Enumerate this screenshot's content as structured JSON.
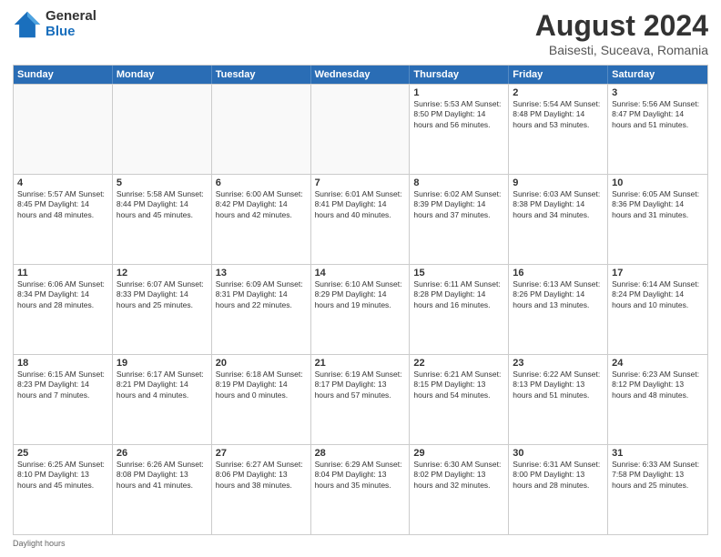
{
  "logo": {
    "general": "General",
    "blue": "Blue"
  },
  "title": {
    "month": "August 2024",
    "location": "Baisesti, Suceava, Romania"
  },
  "header_days": [
    "Sunday",
    "Monday",
    "Tuesday",
    "Wednesday",
    "Thursday",
    "Friday",
    "Saturday"
  ],
  "footer": "Daylight hours",
  "weeks": [
    [
      {
        "day": "",
        "info": "",
        "empty": true
      },
      {
        "day": "",
        "info": "",
        "empty": true
      },
      {
        "day": "",
        "info": "",
        "empty": true
      },
      {
        "day": "",
        "info": "",
        "empty": true
      },
      {
        "day": "1",
        "info": "Sunrise: 5:53 AM\nSunset: 8:50 PM\nDaylight: 14 hours\nand 56 minutes.",
        "empty": false
      },
      {
        "day": "2",
        "info": "Sunrise: 5:54 AM\nSunset: 8:48 PM\nDaylight: 14 hours\nand 53 minutes.",
        "empty": false
      },
      {
        "day": "3",
        "info": "Sunrise: 5:56 AM\nSunset: 8:47 PM\nDaylight: 14 hours\nand 51 minutes.",
        "empty": false
      }
    ],
    [
      {
        "day": "4",
        "info": "Sunrise: 5:57 AM\nSunset: 8:45 PM\nDaylight: 14 hours\nand 48 minutes.",
        "empty": false
      },
      {
        "day": "5",
        "info": "Sunrise: 5:58 AM\nSunset: 8:44 PM\nDaylight: 14 hours\nand 45 minutes.",
        "empty": false
      },
      {
        "day": "6",
        "info": "Sunrise: 6:00 AM\nSunset: 8:42 PM\nDaylight: 14 hours\nand 42 minutes.",
        "empty": false
      },
      {
        "day": "7",
        "info": "Sunrise: 6:01 AM\nSunset: 8:41 PM\nDaylight: 14 hours\nand 40 minutes.",
        "empty": false
      },
      {
        "day": "8",
        "info": "Sunrise: 6:02 AM\nSunset: 8:39 PM\nDaylight: 14 hours\nand 37 minutes.",
        "empty": false
      },
      {
        "day": "9",
        "info": "Sunrise: 6:03 AM\nSunset: 8:38 PM\nDaylight: 14 hours\nand 34 minutes.",
        "empty": false
      },
      {
        "day": "10",
        "info": "Sunrise: 6:05 AM\nSunset: 8:36 PM\nDaylight: 14 hours\nand 31 minutes.",
        "empty": false
      }
    ],
    [
      {
        "day": "11",
        "info": "Sunrise: 6:06 AM\nSunset: 8:34 PM\nDaylight: 14 hours\nand 28 minutes.",
        "empty": false
      },
      {
        "day": "12",
        "info": "Sunrise: 6:07 AM\nSunset: 8:33 PM\nDaylight: 14 hours\nand 25 minutes.",
        "empty": false
      },
      {
        "day": "13",
        "info": "Sunrise: 6:09 AM\nSunset: 8:31 PM\nDaylight: 14 hours\nand 22 minutes.",
        "empty": false
      },
      {
        "day": "14",
        "info": "Sunrise: 6:10 AM\nSunset: 8:29 PM\nDaylight: 14 hours\nand 19 minutes.",
        "empty": false
      },
      {
        "day": "15",
        "info": "Sunrise: 6:11 AM\nSunset: 8:28 PM\nDaylight: 14 hours\nand 16 minutes.",
        "empty": false
      },
      {
        "day": "16",
        "info": "Sunrise: 6:13 AM\nSunset: 8:26 PM\nDaylight: 14 hours\nand 13 minutes.",
        "empty": false
      },
      {
        "day": "17",
        "info": "Sunrise: 6:14 AM\nSunset: 8:24 PM\nDaylight: 14 hours\nand 10 minutes.",
        "empty": false
      }
    ],
    [
      {
        "day": "18",
        "info": "Sunrise: 6:15 AM\nSunset: 8:23 PM\nDaylight: 14 hours\nand 7 minutes.",
        "empty": false
      },
      {
        "day": "19",
        "info": "Sunrise: 6:17 AM\nSunset: 8:21 PM\nDaylight: 14 hours\nand 4 minutes.",
        "empty": false
      },
      {
        "day": "20",
        "info": "Sunrise: 6:18 AM\nSunset: 8:19 PM\nDaylight: 14 hours\nand 0 minutes.",
        "empty": false
      },
      {
        "day": "21",
        "info": "Sunrise: 6:19 AM\nSunset: 8:17 PM\nDaylight: 13 hours\nand 57 minutes.",
        "empty": false
      },
      {
        "day": "22",
        "info": "Sunrise: 6:21 AM\nSunset: 8:15 PM\nDaylight: 13 hours\nand 54 minutes.",
        "empty": false
      },
      {
        "day": "23",
        "info": "Sunrise: 6:22 AM\nSunset: 8:13 PM\nDaylight: 13 hours\nand 51 minutes.",
        "empty": false
      },
      {
        "day": "24",
        "info": "Sunrise: 6:23 AM\nSunset: 8:12 PM\nDaylight: 13 hours\nand 48 minutes.",
        "empty": false
      }
    ],
    [
      {
        "day": "25",
        "info": "Sunrise: 6:25 AM\nSunset: 8:10 PM\nDaylight: 13 hours\nand 45 minutes.",
        "empty": false
      },
      {
        "day": "26",
        "info": "Sunrise: 6:26 AM\nSunset: 8:08 PM\nDaylight: 13 hours\nand 41 minutes.",
        "empty": false
      },
      {
        "day": "27",
        "info": "Sunrise: 6:27 AM\nSunset: 8:06 PM\nDaylight: 13 hours\nand 38 minutes.",
        "empty": false
      },
      {
        "day": "28",
        "info": "Sunrise: 6:29 AM\nSunset: 8:04 PM\nDaylight: 13 hours\nand 35 minutes.",
        "empty": false
      },
      {
        "day": "29",
        "info": "Sunrise: 6:30 AM\nSunset: 8:02 PM\nDaylight: 13 hours\nand 32 minutes.",
        "empty": false
      },
      {
        "day": "30",
        "info": "Sunrise: 6:31 AM\nSunset: 8:00 PM\nDaylight: 13 hours\nand 28 minutes.",
        "empty": false
      },
      {
        "day": "31",
        "info": "Sunrise: 6:33 AM\nSunset: 7:58 PM\nDaylight: 13 hours\nand 25 minutes.",
        "empty": false
      }
    ]
  ]
}
